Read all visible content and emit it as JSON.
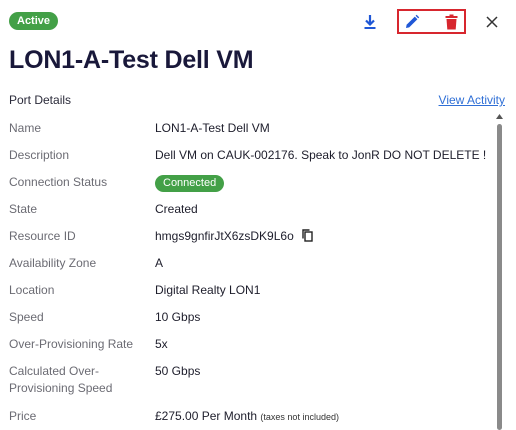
{
  "header": {
    "status_badge": "Active",
    "icons": {
      "download": "download-icon",
      "edit": "pencil-icon",
      "delete": "trash-icon",
      "close": "close-icon"
    },
    "title": "LON1-A-Test Dell VM"
  },
  "colors": {
    "green": "#43a047",
    "blue": "#1f57d6",
    "red": "#d7262e",
    "highlight": "#d7262e",
    "link": "#2f6fd6"
  },
  "section": {
    "title": "Port Details",
    "link": "View Activity"
  },
  "details": {
    "name": {
      "label": "Name",
      "value": "LON1-A-Test Dell VM"
    },
    "description": {
      "label": "Description",
      "value": "Dell VM on CAUK-002176. Speak to JonR DO NOT DELETE !"
    },
    "connection_status": {
      "label": "Connection Status",
      "value": "Connected"
    },
    "state": {
      "label": "State",
      "value": "Created"
    },
    "resource_id": {
      "label": "Resource ID",
      "value": "hmgs9gnfirJtX6zsDK9L6o",
      "icon": "copy-icon"
    },
    "availability_zone": {
      "label": "Availability Zone",
      "value": "A"
    },
    "location": {
      "label": "Location",
      "value": "Digital Realty LON1"
    },
    "speed": {
      "label": "Speed",
      "value": "10 Gbps"
    },
    "over_provisioning_rate": {
      "label": "Over-Provisioning Rate",
      "value": "5x"
    },
    "calculated_speed": {
      "label": "Calculated Over-Provisioning Speed",
      "value": "50 Gbps"
    },
    "price": {
      "label": "Price",
      "value": "£275.00 Per Month",
      "note": "(taxes not included)"
    }
  }
}
